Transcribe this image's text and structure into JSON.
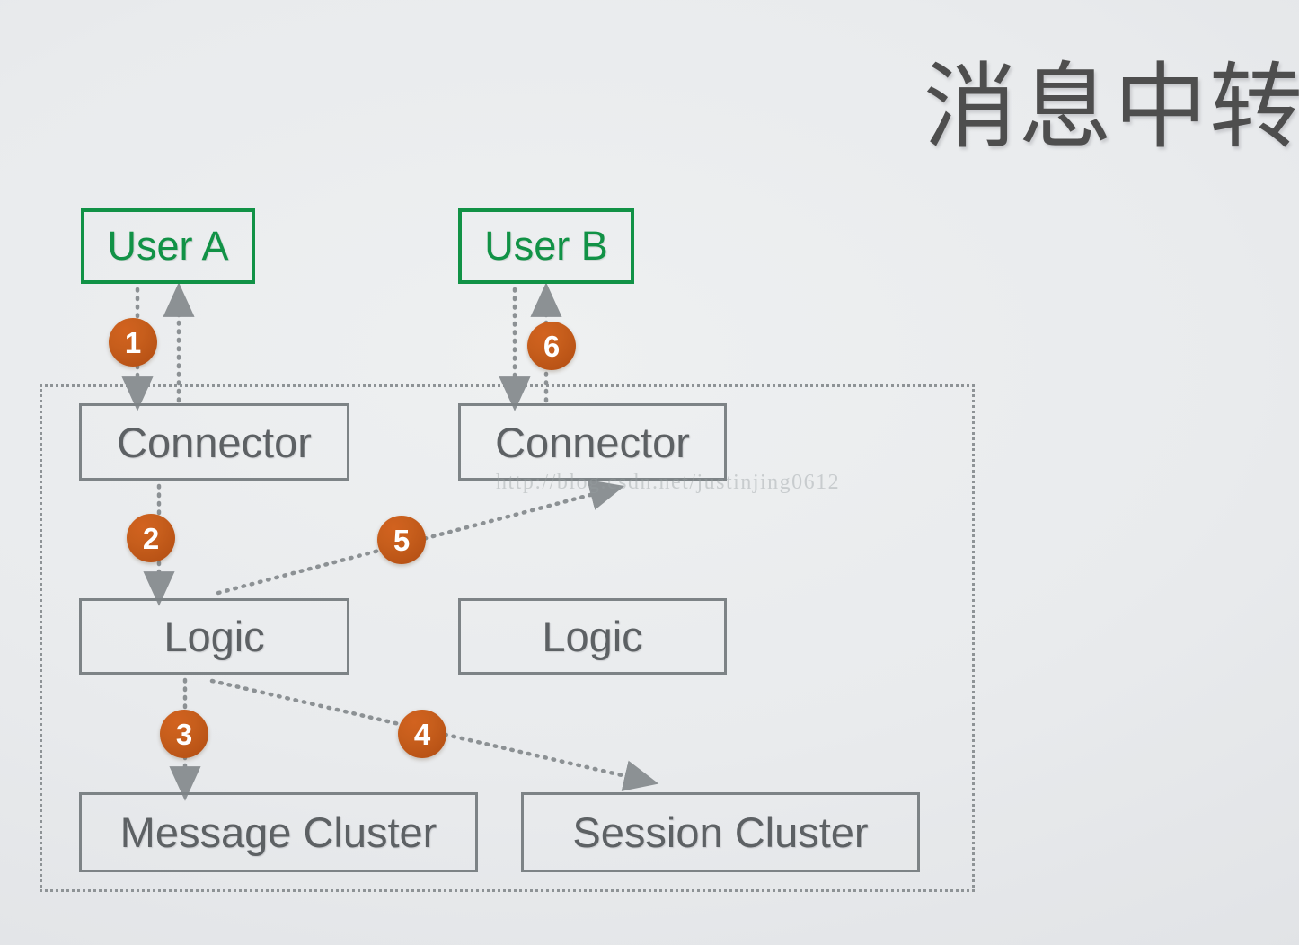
{
  "slide": {
    "title": "消息中转",
    "watermark": "http://blog.csdn.net/justinjing0612",
    "background_color": "#e9ebed",
    "accent_color": "#c75e1c",
    "user_node_color": "#119246",
    "service_node_color": "#7d8386"
  },
  "nodes": {
    "user_a": {
      "label": "User A",
      "kind": "user",
      "color": "#119246"
    },
    "user_b": {
      "label": "User B",
      "kind": "user",
      "color": "#119246"
    },
    "connector_a": {
      "label": "Connector",
      "kind": "service",
      "color": "#7d8386"
    },
    "connector_b": {
      "label": "Connector",
      "kind": "service",
      "color": "#7d8386"
    },
    "logic_a": {
      "label": "Logic",
      "kind": "service",
      "color": "#7d8386"
    },
    "logic_b": {
      "label": "Logic",
      "kind": "service",
      "color": "#7d8386"
    },
    "message_cluster": {
      "label": "Message Cluster",
      "kind": "service",
      "color": "#7d8386"
    },
    "session_cluster": {
      "label": "Session Cluster",
      "kind": "service",
      "color": "#7d8386"
    }
  },
  "steps": [
    {
      "number": "1",
      "from": "user_a",
      "to": "connector_a"
    },
    {
      "number": "2",
      "from": "connector_a",
      "to": "logic_a"
    },
    {
      "number": "3",
      "from": "logic_a",
      "to": "message_cluster"
    },
    {
      "number": "4",
      "from": "logic_a",
      "to": "session_cluster"
    },
    {
      "number": "5",
      "from": "logic_a",
      "to": "connector_b"
    },
    {
      "number": "6",
      "from": "connector_b",
      "to": "user_b"
    }
  ],
  "return_flows": [
    {
      "from": "connector_a",
      "to": "user_a"
    },
    {
      "from": "user_b",
      "to": "connector_b"
    }
  ]
}
